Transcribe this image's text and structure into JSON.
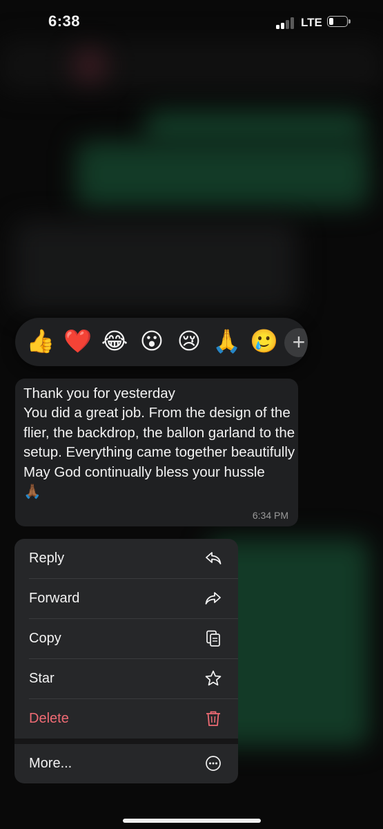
{
  "status_bar": {
    "time": "6:38",
    "network": "LTE",
    "signal_bars_active": 2,
    "signal_bars_total": 4,
    "battery_level_fraction": 0.25
  },
  "reactions": {
    "emojis": [
      "👍",
      "❤️",
      "😂",
      "😮",
      "😢",
      "🙏",
      "🥲"
    ],
    "add_symbol": "+"
  },
  "message": {
    "text": "Thank you for yesterday\nYou did a great job. From the design of the flier, the backdrop, the ballon garland to the setup. Everything came together beautifully\nMay God continually bless your hussle\n🙏🏾",
    "time": "6:34 PM"
  },
  "context_menu": {
    "items": [
      {
        "label": "Reply",
        "icon": "reply-icon"
      },
      {
        "label": "Forward",
        "icon": "forward-icon"
      },
      {
        "label": "Copy",
        "icon": "copy-icon"
      },
      {
        "label": "Star",
        "icon": "star-icon"
      },
      {
        "label": "Delete",
        "icon": "trash-icon",
        "color": "#ef6b74"
      },
      {
        "label": "More...",
        "icon": "more-icon"
      }
    ]
  },
  "colors": {
    "danger": "#ef6b74",
    "surface": "#1f2022",
    "menu_surface": "#262729",
    "blurred_outgoing_bubble": "#1e5a3c"
  }
}
